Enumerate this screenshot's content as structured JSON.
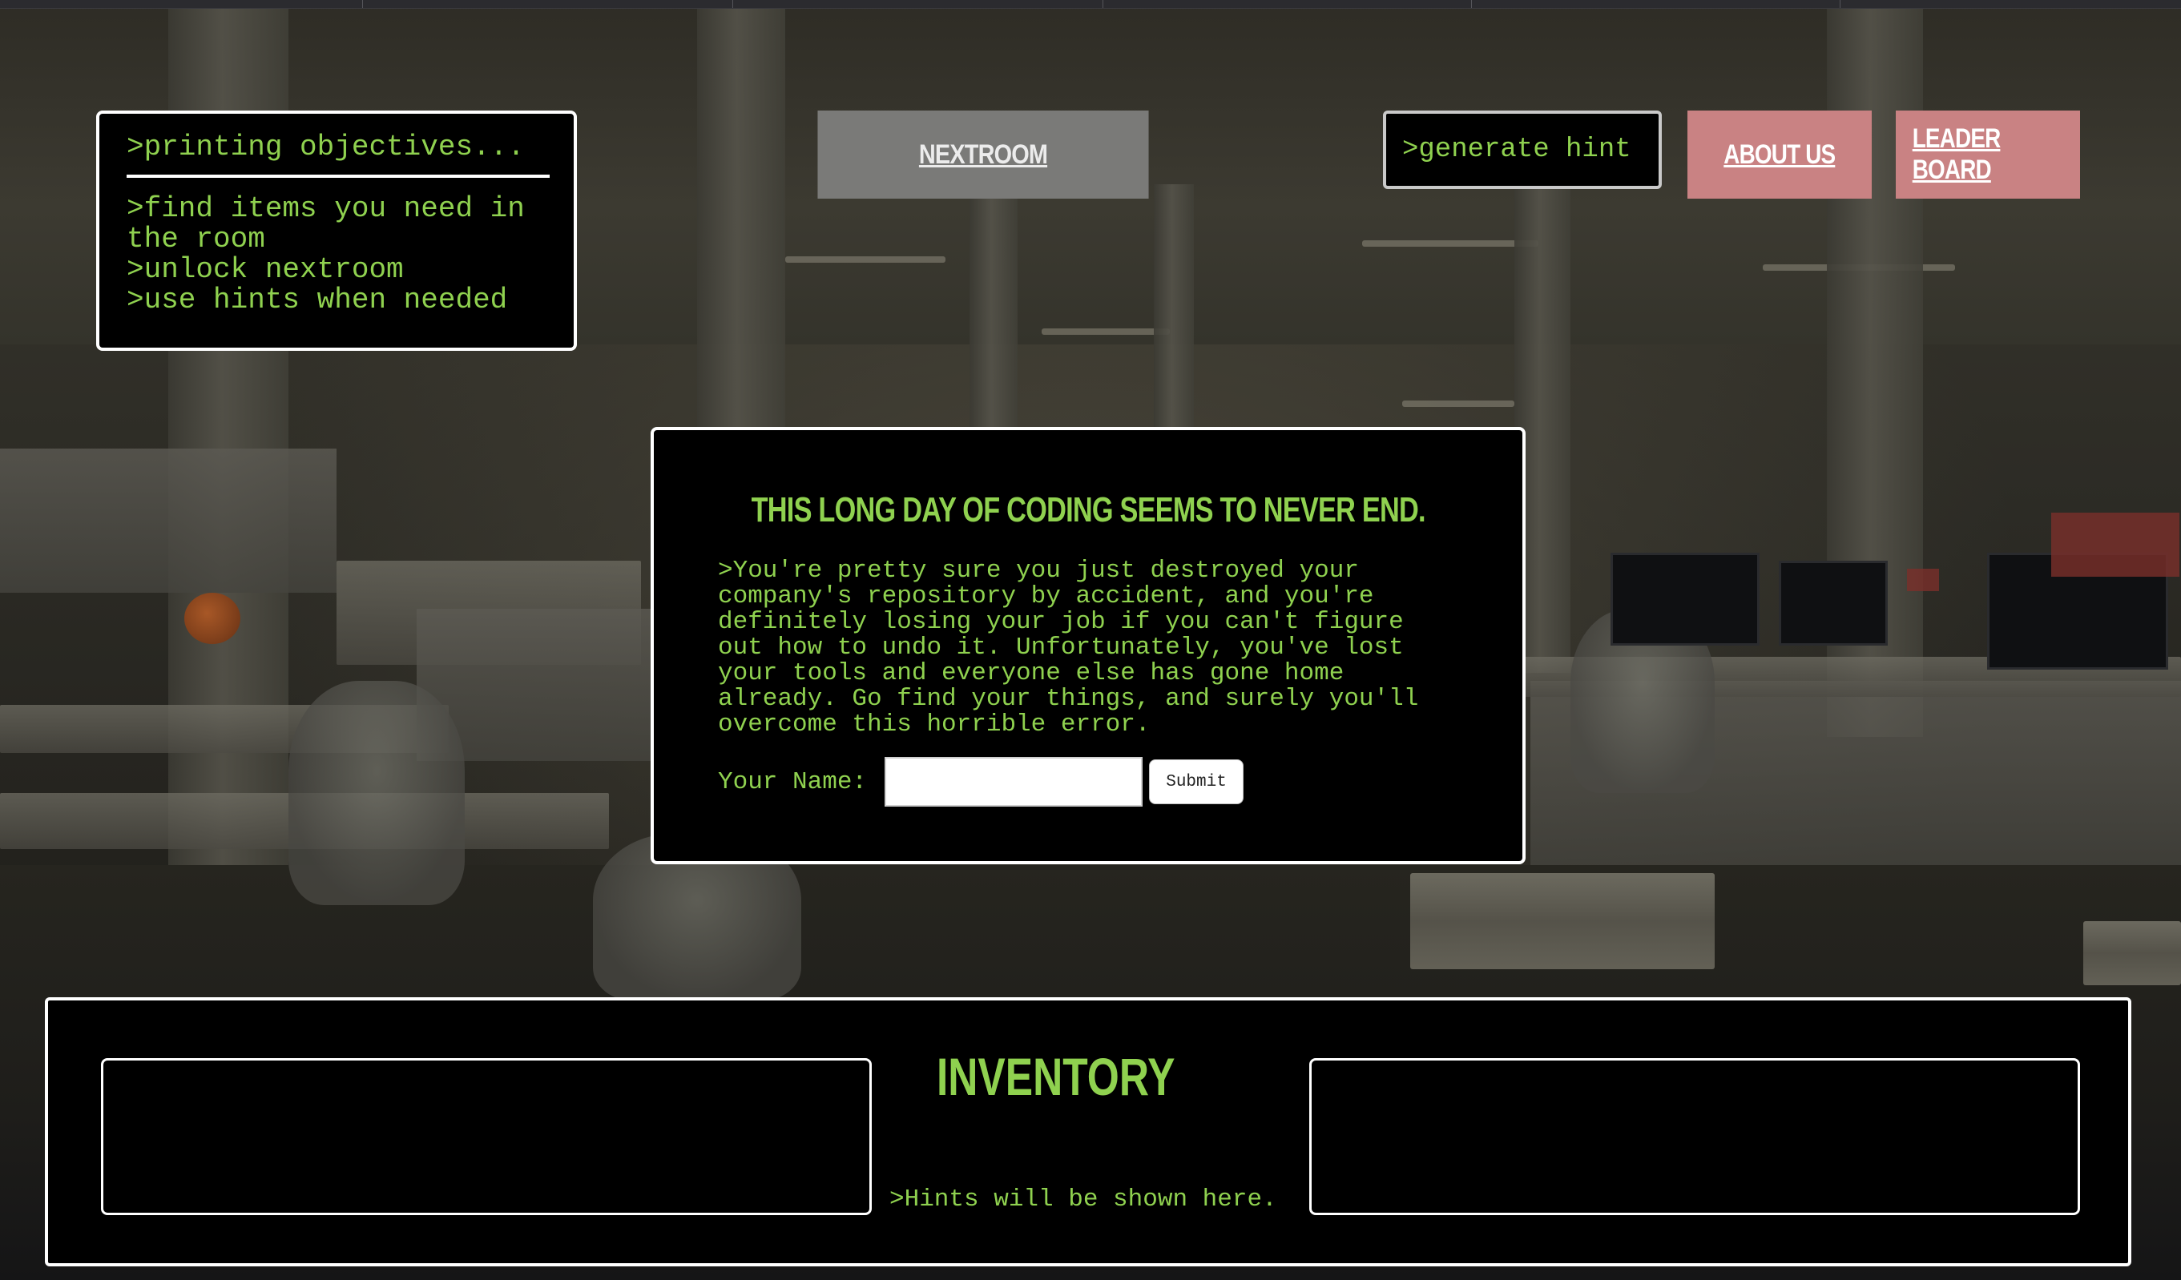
{
  "objectives": {
    "title": ">printing objectives...",
    "items": [
      ">find items you need in the room",
      ">unlock nextroom",
      ">use hints when needed"
    ]
  },
  "nav": {
    "nextroom_label": "NEXTROOM",
    "hint_label": ">generate hint",
    "about_label": "ABOUT US",
    "leaderboard_label": "LEADER BOARD"
  },
  "intro": {
    "title": "THIS LONG DAY OF CODING SEEMS TO NEVER END.",
    "body": ">You're pretty sure you just destroyed your company's repository by accident, and you're definitely losing your job if you can't figure out how to undo it. Unfortunately, you've lost your tools and everyone else has gone home already. Go find your things, and surely you'll overcome this horrible error.",
    "name_label": "Your Name:",
    "name_value": "",
    "submit_label": "Submit"
  },
  "inventory": {
    "title": "INVENTORY",
    "hint_text": ">Hints will be shown here."
  },
  "colors": {
    "terminal_green": "#8fd14f",
    "panel_bg": "#000000",
    "pink_button": "#c98283",
    "gray_button": "#7a7a78"
  }
}
